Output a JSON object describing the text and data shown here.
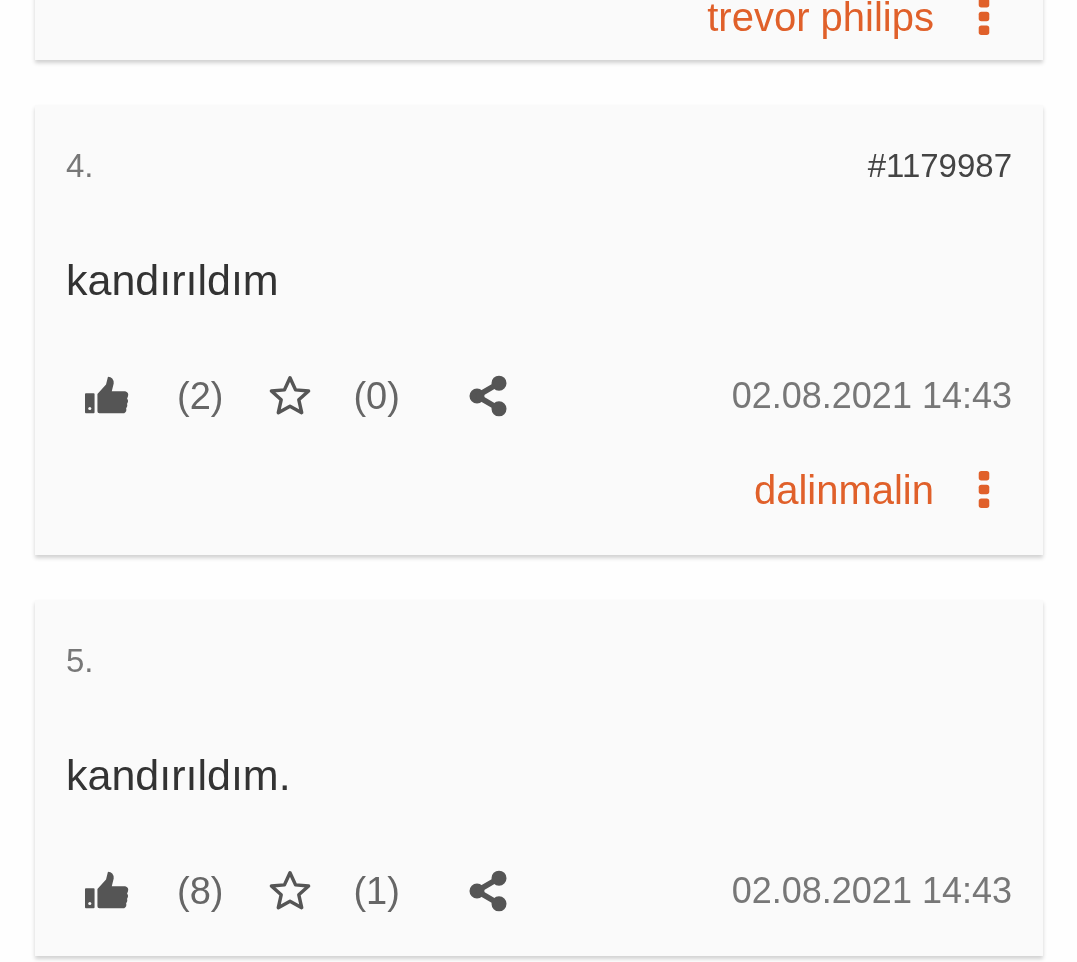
{
  "entries": [
    {
      "author": "trevor philips",
      "partial": true
    },
    {
      "number": "4.",
      "id": "#1179987",
      "text": "kandırıldım",
      "likes": "(2)",
      "favorites": "(0)",
      "date": "02.08.2021 14:43",
      "author": "dalinmalin"
    },
    {
      "number": "5.",
      "text": "kandırıldım.",
      "likes": "(8)",
      "favorites": "(1)",
      "date": "02.08.2021 14:43"
    }
  ]
}
